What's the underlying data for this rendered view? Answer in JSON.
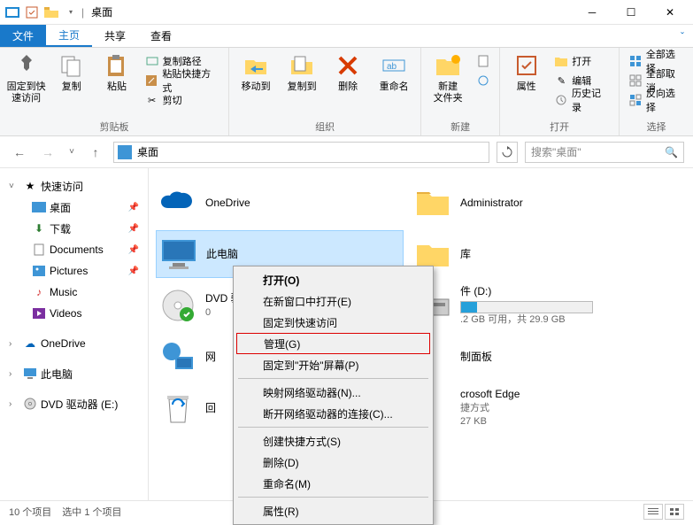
{
  "titlebar": {
    "title": "桌面"
  },
  "tabs": {
    "file": "文件",
    "home": "主页",
    "share": "共享",
    "view": "查看"
  },
  "ribbon": {
    "clipboard": {
      "label": "剪贴板",
      "pin": "固定到快\n速访问",
      "copy": "复制",
      "paste": "粘贴",
      "copypath": "复制路径",
      "pasteshortcut": "粘贴快捷方式",
      "cut": "剪切"
    },
    "organize": {
      "label": "组织",
      "moveto": "移动到",
      "copyto": "复制到",
      "delete": "删除",
      "rename": "重命名"
    },
    "new": {
      "label": "新建",
      "newfolder": "新建\n文件夹"
    },
    "open": {
      "label": "打开",
      "properties": "属性",
      "open": "打开",
      "edit": "编辑",
      "history": "历史记录"
    },
    "select": {
      "label": "选择",
      "selectall": "全部选择",
      "selectnone": "全部取消",
      "invert": "反向选择"
    }
  },
  "nav": {
    "location": "桌面",
    "search_placeholder": "搜索\"桌面\""
  },
  "tree": {
    "quick": "快速访问",
    "desktop": "桌面",
    "downloads": "下载",
    "documents": "Documents",
    "pictures": "Pictures",
    "music": "Music",
    "videos": "Videos",
    "onedrive": "OneDrive",
    "thispc": "此电脑",
    "dvd": "DVD 驱动器 (E:)"
  },
  "items": {
    "onedrive": "OneDrive",
    "admin": "Administrator",
    "thispc": "此电脑",
    "libs": "库",
    "dvd_name": "DVD 驱动器 CP",
    "dvd_sub": "0",
    "soft_name": "件 (D:)",
    "soft_sub": ".2 GB 可用，共 29.9 GB",
    "network": "网",
    "ctrl_name": "制面板",
    "recycle": "回",
    "edge_name": "crosoft Edge",
    "edge_sub1": "捷方式",
    "edge_sub2": "27 KB"
  },
  "context": {
    "open": "打开(O)",
    "newwin": "在新窗口中打开(E)",
    "pinquick": "固定到快速访问",
    "manage": "管理(G)",
    "pinstart": "固定到\"开始\"屏幕(P)",
    "mapdrive": "映射网络驱动器(N)...",
    "disconnect": "断开网络驱动器的连接(C)...",
    "shortcut": "创建快捷方式(S)",
    "delete": "删除(D)",
    "rename": "重命名(M)",
    "props": "属性(R)"
  },
  "status": {
    "count": "10 个项目",
    "selected": "选中 1 个项目"
  }
}
